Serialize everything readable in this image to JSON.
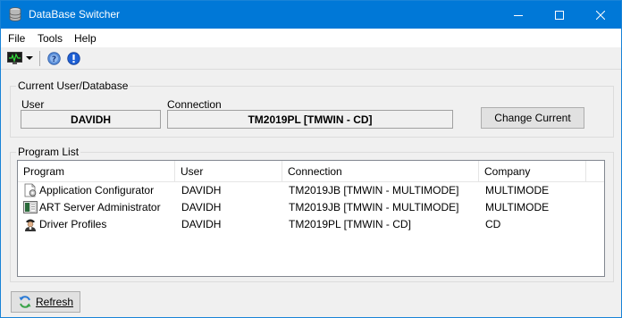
{
  "window": {
    "title": "DataBase Switcher"
  },
  "menu": {
    "items": [
      "File",
      "Tools",
      "Help"
    ]
  },
  "toolbar": {
    "icons": [
      "monitor-icon",
      "dropdown-arrow-icon",
      "help-icon",
      "info-icon"
    ]
  },
  "current": {
    "group_title": "Current User/Database",
    "user_label": "User",
    "user_value": "DAVIDH",
    "connection_label": "Connection",
    "connection_value": "TM2019PL [TMWIN - CD]",
    "change_button": "Change Current"
  },
  "program_list": {
    "group_title": "Program List",
    "columns": [
      "Program",
      "User",
      "Connection",
      "Company"
    ],
    "rows": [
      {
        "program": "Application Configurator",
        "user": "DAVIDH",
        "connection": "TM2019JB [TMWIN - MULTIMODE]",
        "company": "MULTIMODE",
        "icon": "configurator-icon"
      },
      {
        "program": "ART Server Administrator",
        "user": "DAVIDH",
        "connection": "TM2019JB [TMWIN - MULTIMODE]",
        "company": "MULTIMODE",
        "icon": "server-admin-icon"
      },
      {
        "program": "Driver Profiles",
        "user": "DAVIDH",
        "connection": "TM2019PL [TMWIN - CD]",
        "company": "CD",
        "icon": "driver-icon"
      }
    ]
  },
  "footer": {
    "refresh_label": "Refresh"
  },
  "colors": {
    "titlebar": "#0078d7",
    "background": "#f0f0f0"
  }
}
